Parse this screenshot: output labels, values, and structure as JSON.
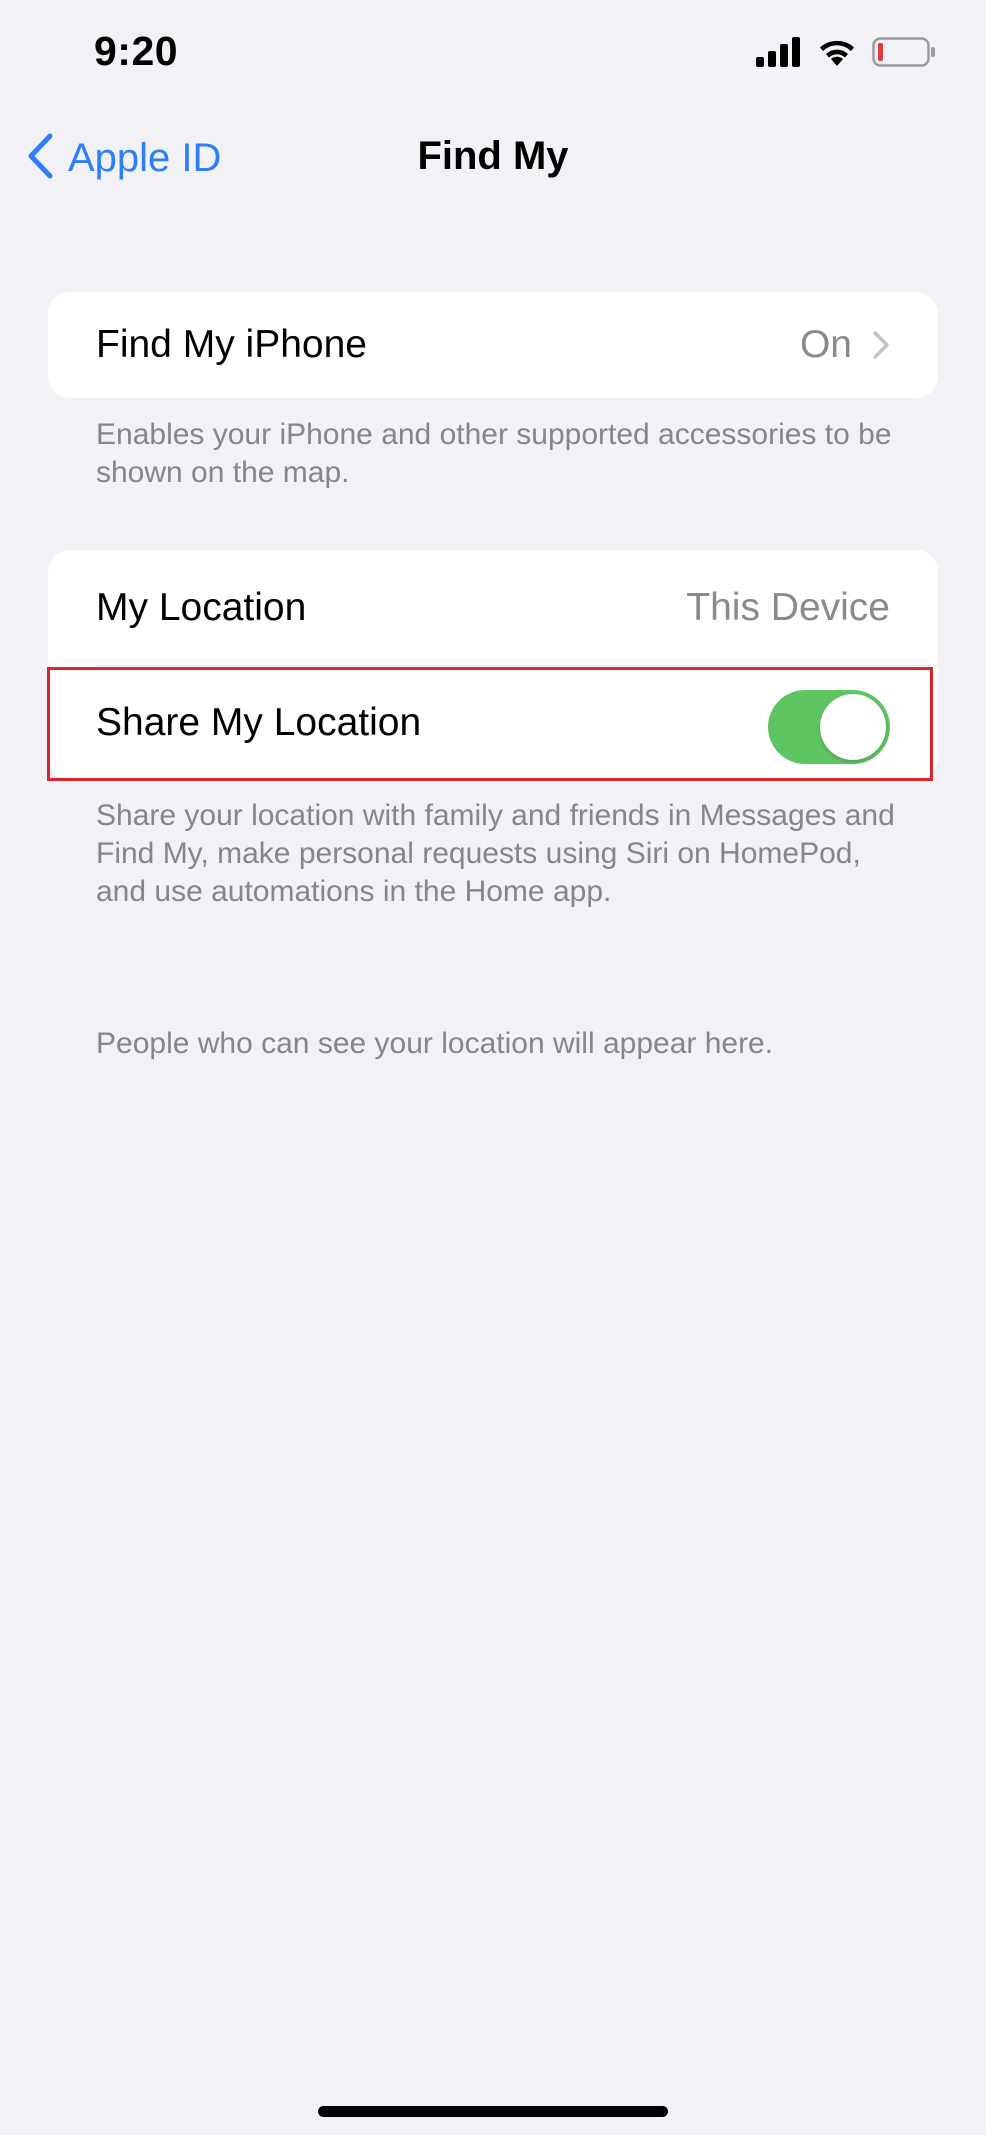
{
  "status_bar": {
    "time": "9:20",
    "icons": [
      "cellular-signal-icon",
      "wifi-icon",
      "battery-low-icon"
    ],
    "battery_color": "#e23a3a"
  },
  "nav": {
    "back_label": "Apple ID",
    "title": "Find My"
  },
  "find_my_iphone": {
    "label": "Find My iPhone",
    "value": "On",
    "footer": "Enables your iPhone and other supported accessories to be shown on the map."
  },
  "location_group": {
    "my_location_label": "My Location",
    "my_location_value": "This Device",
    "share_label": "Share My Location",
    "share_enabled": true,
    "footer": "Share your location with family and friends in Messages and Find My, make personal requests using Siri on HomePod, and use automations in the Home app."
  },
  "people_note": "People who can see your location will appear here.",
  "colors": {
    "accent": "#2f7ef6",
    "toggle_on": "#5fc562",
    "highlight": "#d8262d",
    "background": "#f1f1f6"
  }
}
